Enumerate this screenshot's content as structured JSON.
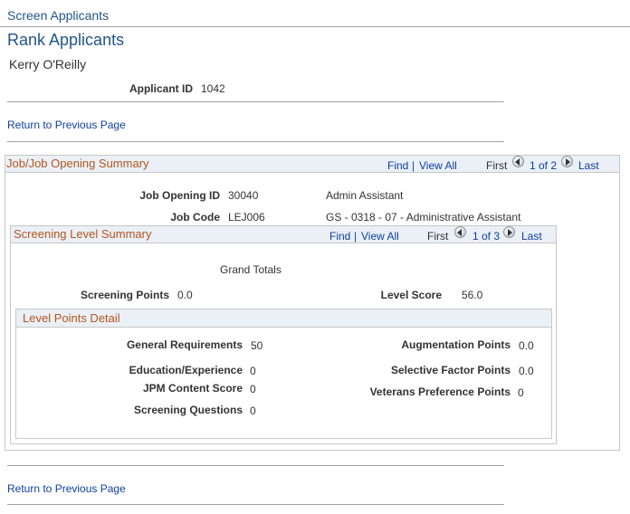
{
  "breadcrumb": "Screen Applicants",
  "page_title": "Rank Applicants",
  "applicant_name": "Kerry O'Reilly",
  "applicant_id": {
    "label": "Applicant ID",
    "value": "1042"
  },
  "return_link": "Return to Previous Page",
  "job_opening_summary": {
    "title": "Job/Job Opening Summary",
    "find": "Find",
    "separator": "|",
    "view_all": "View All",
    "first": "First",
    "position": "1 of 2",
    "last": "Last",
    "job_opening_id": {
      "label": "Job Opening ID",
      "value": "30040",
      "description": "Admin Assistant"
    },
    "job_code": {
      "label": "Job Code",
      "value": "LEJ006",
      "description": "GS - 0318 - 07 - Administrative Assistant"
    }
  },
  "screening_level_summary": {
    "title": "Screening Level Summary",
    "find": "Find",
    "separator": "|",
    "view_all": "View All",
    "first": "First",
    "position": "1 of 3",
    "last": "Last",
    "grand_totals": "Grand Totals",
    "screening_points": {
      "label": "Screening Points",
      "value": "0.0"
    },
    "level_score": {
      "label": "Level Score",
      "value": "56.0"
    }
  },
  "level_points_detail": {
    "title": "Level Points Detail",
    "general_requirements": {
      "label": "General Requirements",
      "value": "50"
    },
    "education_experience": {
      "label": "Education/Experience",
      "value": "0"
    },
    "jpm_content_score": {
      "label": "JPM Content Score",
      "value": "0"
    },
    "screening_questions": {
      "label": "Screening Questions",
      "value": "0"
    },
    "augmentation_points": {
      "label": "Augmentation Points",
      "value": "0.0"
    },
    "selective_factor_points": {
      "label": "Selective Factor Points",
      "value": "0.0"
    },
    "veterans_preference_points": {
      "label": "Veterans Preference Points",
      "value": "0"
    }
  }
}
